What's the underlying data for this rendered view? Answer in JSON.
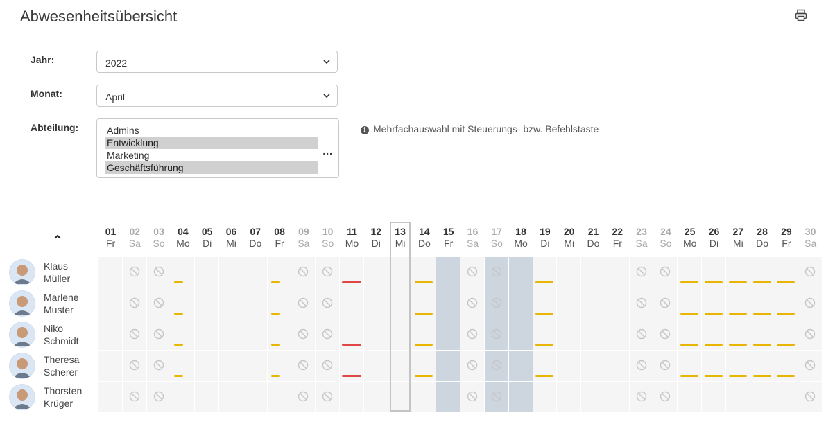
{
  "page": {
    "title": "Abwesenheitsübersicht"
  },
  "filters": {
    "year_label": "Jahr:",
    "year_value": "2022",
    "month_label": "Monat:",
    "month_value": "April",
    "department_label": "Abteilung:",
    "departments": [
      {
        "label": "Admins",
        "selected": false
      },
      {
        "label": "Entwicklung",
        "selected": true
      },
      {
        "label": "Marketing",
        "selected": false
      },
      {
        "label": "Geschäftsführung",
        "selected": true
      }
    ],
    "more": "...",
    "hint": "Mehrfachauswahl mit Steuerungs- bzw. Befehlstaste"
  },
  "days": [
    {
      "n": "01",
      "w": "Fr",
      "weekend": false
    },
    {
      "n": "02",
      "w": "Sa",
      "weekend": true
    },
    {
      "n": "03",
      "w": "So",
      "weekend": true
    },
    {
      "n": "04",
      "w": "Mo",
      "weekend": false
    },
    {
      "n": "05",
      "w": "Di",
      "weekend": false
    },
    {
      "n": "06",
      "w": "Mi",
      "weekend": false
    },
    {
      "n": "07",
      "w": "Do",
      "weekend": false
    },
    {
      "n": "08",
      "w": "Fr",
      "weekend": false
    },
    {
      "n": "09",
      "w": "Sa",
      "weekend": true
    },
    {
      "n": "10",
      "w": "So",
      "weekend": true
    },
    {
      "n": "11",
      "w": "Mo",
      "weekend": false
    },
    {
      "n": "12",
      "w": "Di",
      "weekend": false
    },
    {
      "n": "13",
      "w": "Mi",
      "weekend": false,
      "today": true
    },
    {
      "n": "14",
      "w": "Do",
      "weekend": false
    },
    {
      "n": "15",
      "w": "Fr",
      "weekend": false,
      "holiday": true
    },
    {
      "n": "16",
      "w": "Sa",
      "weekend": true
    },
    {
      "n": "17",
      "w": "So",
      "weekend": true,
      "holiday": true
    },
    {
      "n": "18",
      "w": "Mo",
      "weekend": false,
      "holiday": true
    },
    {
      "n": "19",
      "w": "Di",
      "weekend": false
    },
    {
      "n": "20",
      "w": "Mi",
      "weekend": false
    },
    {
      "n": "21",
      "w": "Do",
      "weekend": false
    },
    {
      "n": "22",
      "w": "Fr",
      "weekend": false
    },
    {
      "n": "23",
      "w": "Sa",
      "weekend": true
    },
    {
      "n": "24",
      "w": "So",
      "weekend": true
    },
    {
      "n": "25",
      "w": "Mo",
      "weekend": false
    },
    {
      "n": "26",
      "w": "Di",
      "weekend": false
    },
    {
      "n": "27",
      "w": "Mi",
      "weekend": false
    },
    {
      "n": "28",
      "w": "Do",
      "weekend": false
    },
    {
      "n": "29",
      "w": "Fr",
      "weekend": false
    },
    {
      "n": "30",
      "w": "Sa",
      "weekend": true
    }
  ],
  "people": [
    {
      "first": "Klaus",
      "last": "Müller",
      "absences": {
        "04": "y-short",
        "08": "y-short",
        "11": "r",
        "14": "y",
        "19": "y",
        "25": "y",
        "26": "y",
        "27": "y",
        "28": "y",
        "29": "y"
      }
    },
    {
      "first": "Marlene",
      "last": "Muster",
      "absences": {
        "04": "y-short",
        "08": "y-short",
        "14": "y",
        "19": "y",
        "25": "y",
        "26": "y",
        "27": "y",
        "28": "y",
        "29": "y"
      }
    },
    {
      "first": "Niko",
      "last": "Schmidt",
      "absences": {
        "04": "y-short",
        "08": "y-short",
        "11": "r",
        "14": "y",
        "19": "y",
        "25": "y",
        "26": "y",
        "27": "y",
        "28": "y",
        "29": "y"
      }
    },
    {
      "first": "Theresa",
      "last": "Scherer",
      "absences": {
        "04": "y-short",
        "08": "y-short",
        "11": "r",
        "14": "y",
        "19": "y",
        "25": "y",
        "26": "y",
        "27": "y",
        "28": "y",
        "29": "y"
      }
    },
    {
      "first": "Thorsten",
      "last": "Krüger",
      "absences": {}
    }
  ],
  "colors": {
    "vacation": "#e8b600",
    "sick": "#e04646",
    "holiday": "#cdd5df"
  },
  "icons": {
    "print": "printer-icon",
    "sort": "chevron-up-icon",
    "unavailable": "no-entry-icon",
    "info": "info-icon"
  }
}
